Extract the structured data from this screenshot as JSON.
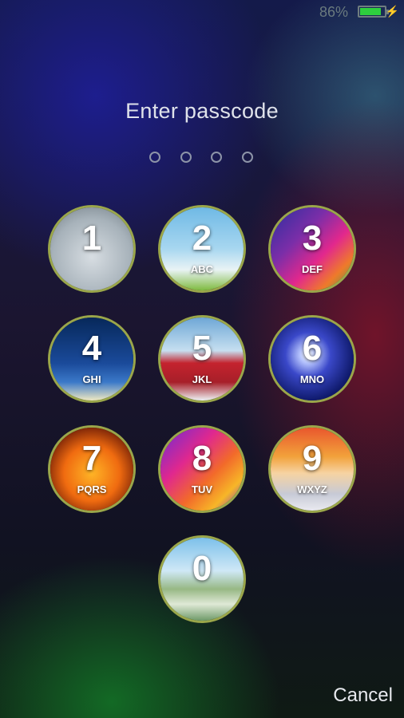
{
  "status_bar": {
    "battery_percent": "86%",
    "battery_level": 0.86,
    "battery_color": "#2ecf3e",
    "charging_icon": "bolt-icon"
  },
  "title": "Enter passcode",
  "passcode_dots": 4,
  "keys": [
    {
      "digit": "1",
      "letters": "",
      "theme": "hand-holding-money"
    },
    {
      "digit": "2",
      "letters": "ABC",
      "theme": "umbrella-sky"
    },
    {
      "digit": "3",
      "letters": "DEF",
      "theme": "colorful-dollar"
    },
    {
      "digit": "4",
      "letters": "GHI",
      "theme": "blue-galaxy"
    },
    {
      "digit": "5",
      "letters": "JKL",
      "theme": "red-barn"
    },
    {
      "digit": "6",
      "letters": "MNO",
      "theme": "glowing-planet"
    },
    {
      "digit": "7",
      "letters": "PQRS",
      "theme": "fire-dollar"
    },
    {
      "digit": "8",
      "letters": "TUV",
      "theme": "rainbow-waves"
    },
    {
      "digit": "9",
      "letters": "WXYZ",
      "theme": "winter-sunset"
    },
    {
      "digit": "0",
      "letters": "",
      "theme": "money-pile"
    }
  ],
  "cancel_label": "Cancel",
  "colors": {
    "key_ring": "#9aa64a",
    "text": "#ffffff"
  }
}
